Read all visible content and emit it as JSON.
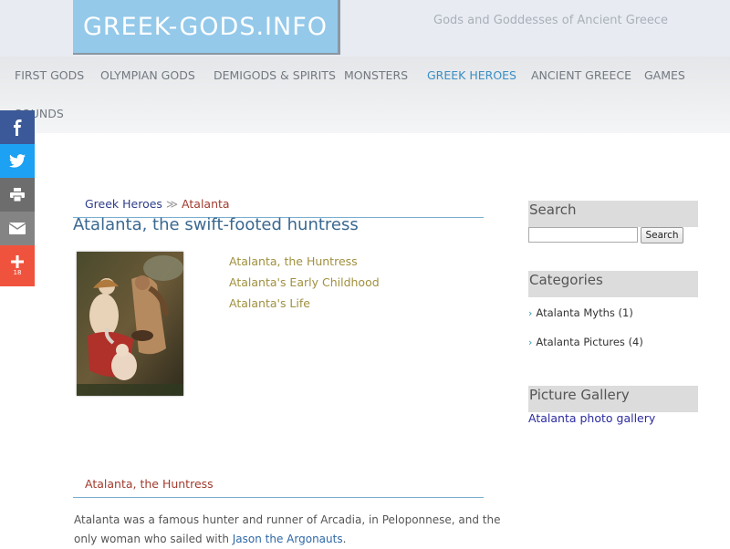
{
  "header": {
    "logo": "GREEK-GODS.INFO",
    "tagline": "Gods and Goddesses of Ancient Greece"
  },
  "nav": {
    "items": [
      {
        "label": "FIRST GODS"
      },
      {
        "label": "OLYMPIAN GODS"
      },
      {
        "label": "DEMIGODS & SPIRITS"
      },
      {
        "label": "MONSTERS"
      },
      {
        "label": "GREEK HEROES",
        "active": true
      },
      {
        "label": "ANCIENT GREECE"
      },
      {
        "label": "GAMES"
      },
      {
        "label": "SOUNDS"
      }
    ]
  },
  "share": {
    "count": "18",
    "colors": {
      "facebook": "#3b5998",
      "twitter": "#1da1f2",
      "print": "#6d6d6d",
      "email": "#848484",
      "more": "#f0533d"
    }
  },
  "breadcrumb": {
    "parent": "Greek Heroes",
    "separator": "≫",
    "current": "Atalanta"
  },
  "article": {
    "title": "Atalanta, the swift-footed huntress",
    "toc": [
      "Atalanta, the Huntress",
      "Atalanta's Early Childhood",
      "Atalanta's Life"
    ],
    "section_heading": "Atalanta, the Huntress",
    "body_start": "Atalanta was a famous hunter and runner of Arcadia, in Peloponnese, and the only woman who sailed with ",
    "body_link": "Jason the Argonauts",
    "body_end": "."
  },
  "sidebar": {
    "search": {
      "heading": "Search",
      "placeholder": "",
      "button": "Search"
    },
    "categories": {
      "heading": "Categories",
      "items": [
        "Atalanta Myths (1)",
        "Atalanta Pictures (4)"
      ]
    },
    "gallery": {
      "heading": "Picture Gallery",
      "link": "Atalanta photo gallery"
    }
  },
  "colors": {
    "logo_bg": "#94c9ea",
    "nav_active": "#3a8fc4",
    "title": "#3a6890",
    "link_blue": "#2e3d8a",
    "link_red": "#a23b2e",
    "toc_gold": "#a0903e"
  }
}
